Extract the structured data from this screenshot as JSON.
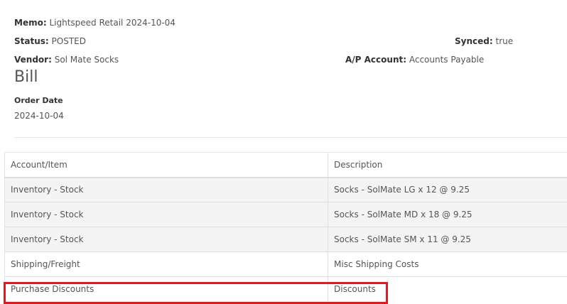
{
  "header": {
    "memo_label": "Memo:",
    "memo_value": "Lightspeed Retail 2024-10-04",
    "status_label": "Status:",
    "status_value": "POSTED",
    "synced_label": "Synced:",
    "synced_value": "true",
    "vendor_label": "Vendor:",
    "vendor_value": "Sol Mate Socks",
    "ap_label": "A/P Account:",
    "ap_value": "Accounts Payable",
    "title": "Bill",
    "order_date_label": "Order Date",
    "order_date_value": "2024-10-04"
  },
  "table": {
    "columns": [
      "Account/Item",
      "Description"
    ],
    "rows": [
      {
        "account": "Inventory - Stock",
        "description": "Socks - SolMate LG x 12 @ 9.25"
      },
      {
        "account": "Inventory - Stock",
        "description": "Socks - SolMate MD x 18 @ 9.25"
      },
      {
        "account": "Inventory - Stock",
        "description": "Socks - SolMate SM x 11 @ 9.25"
      },
      {
        "account": "Shipping/Freight",
        "description": "Misc Shipping Costs"
      },
      {
        "account": "Purchase Discounts",
        "description": "Discounts"
      }
    ]
  },
  "colors": {
    "highlight": "#e3191f",
    "row_shade": "#f4f4f4"
  }
}
